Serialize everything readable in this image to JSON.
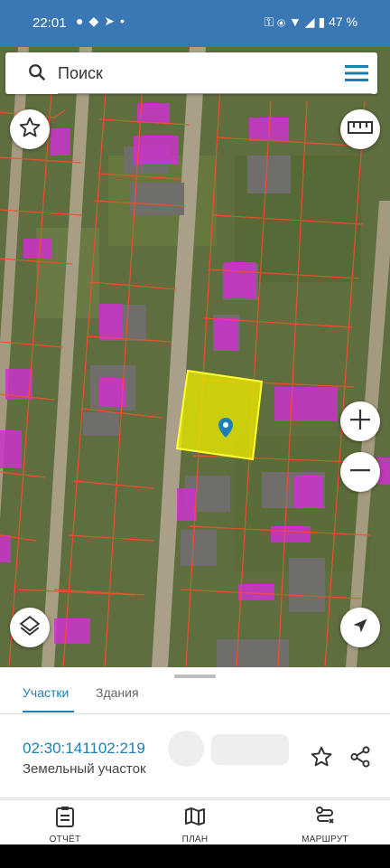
{
  "status_bar": {
    "time": "22:01",
    "left_icons": [
      "message-icon",
      "chat-icon",
      "telegram-icon",
      "dot-icon"
    ],
    "right_icons": [
      "key-icon",
      "location-icon",
      "wifi-icon",
      "signal-icon",
      "battery-icon"
    ],
    "battery": "47 %"
  },
  "search": {
    "placeholder": "Поиск"
  },
  "map": {
    "selected_parcel_color": "#e6e600",
    "building_color": "#cc33cc",
    "boundary_color": "#ff4a2a"
  },
  "tabs": {
    "active": "Участки",
    "inactive": "Здания"
  },
  "parcel": {
    "cadastral_number": "02:30:141102:219",
    "type": "Земельный участок"
  },
  "bottom_nav": {
    "report": "ОТЧЁТ",
    "plan": "ПЛАН",
    "route": "МАРШРУТ"
  },
  "colors": {
    "status_bar": "#3a78b5",
    "accent": "#1b7fb8"
  }
}
